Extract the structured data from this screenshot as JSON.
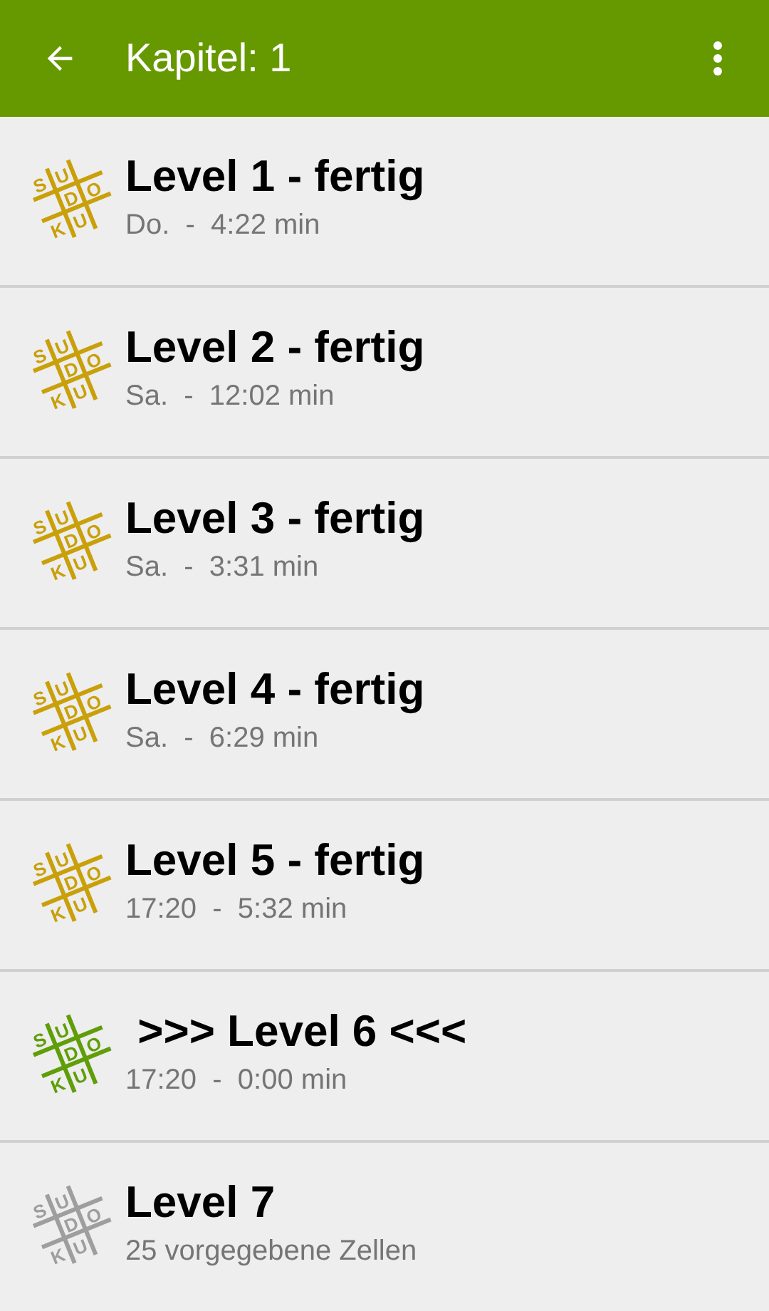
{
  "app_bar": {
    "title": "Kapitel: 1"
  },
  "levels": [
    {
      "title": "Level 1 - fertig",
      "subtitle": "Do.  -  4:22 min",
      "kind": "done",
      "icon_letters": [
        "S",
        "U",
        "D",
        "O",
        "K",
        "U"
      ]
    },
    {
      "title": "Level 2 - fertig",
      "subtitle": "Sa.  -  12:02 min",
      "kind": "done",
      "icon_letters": [
        "S",
        "U",
        "D",
        "O",
        "K",
        "U"
      ]
    },
    {
      "title": "Level 3 - fertig",
      "subtitle": "Sa.  -  3:31 min",
      "kind": "done",
      "icon_letters": [
        "S",
        "U",
        "D",
        "O",
        "K",
        "U"
      ]
    },
    {
      "title": "Level 4 - fertig",
      "subtitle": "Sa.  -  6:29 min",
      "kind": "done",
      "icon_letters": [
        "S",
        "U",
        "D",
        "O",
        "K",
        "U"
      ]
    },
    {
      "title": "Level 5 - fertig",
      "subtitle": "17:20  -  5:32 min",
      "kind": "done",
      "icon_letters": [
        "S",
        "U",
        "D",
        "O",
        "K",
        "U"
      ]
    },
    {
      "title": " >>> Level 6 <<<",
      "subtitle": "17:20  -  0:00 min",
      "kind": "current",
      "icon_letters": [
        "S",
        "U",
        "D",
        "O",
        "K",
        "U"
      ]
    },
    {
      "title": "Level 7",
      "subtitle": "25 vorgegebene Zellen",
      "kind": "locked",
      "icon_letters": [
        "S",
        "U",
        "D",
        "O",
        "K",
        "U"
      ]
    }
  ]
}
